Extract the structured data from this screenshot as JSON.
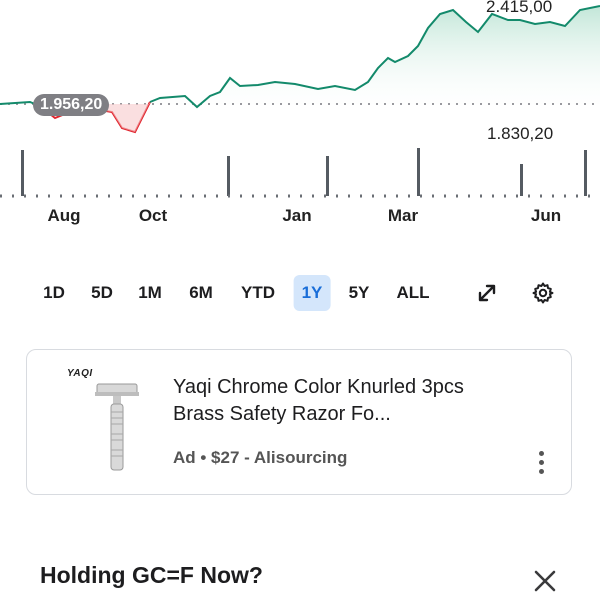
{
  "chart": {
    "high_label": "2.415,00",
    "prev_close_label": "1.956,20",
    "low_label": "1.830,20",
    "months": [
      "Aug",
      "Oct",
      "Jan",
      "Mar",
      "Jun"
    ],
    "line_color": "#138a6b",
    "below_color": "#e0252e",
    "fill_color": "#d6efe6"
  },
  "range_selector": {
    "options": [
      "1D",
      "5D",
      "1M",
      "6M",
      "YTD",
      "1Y",
      "5Y",
      "ALL"
    ],
    "selected": "1Y",
    "active_bg": "#d4e6fb",
    "active_color": "#1a6ed8"
  },
  "icons": {
    "expand": "expand-icon",
    "settings": "gear-icon",
    "more": "more-vertical-icon",
    "close": "close-icon"
  },
  "ad": {
    "brand_logo": "YAQI",
    "title": "Yaqi Chrome Color Knurled 3pcs  Brass Safety Razor  Fo...",
    "meta": "Ad • $27 - Alisourcing"
  },
  "holding": {
    "title": "Holding GC=F Now?"
  }
}
